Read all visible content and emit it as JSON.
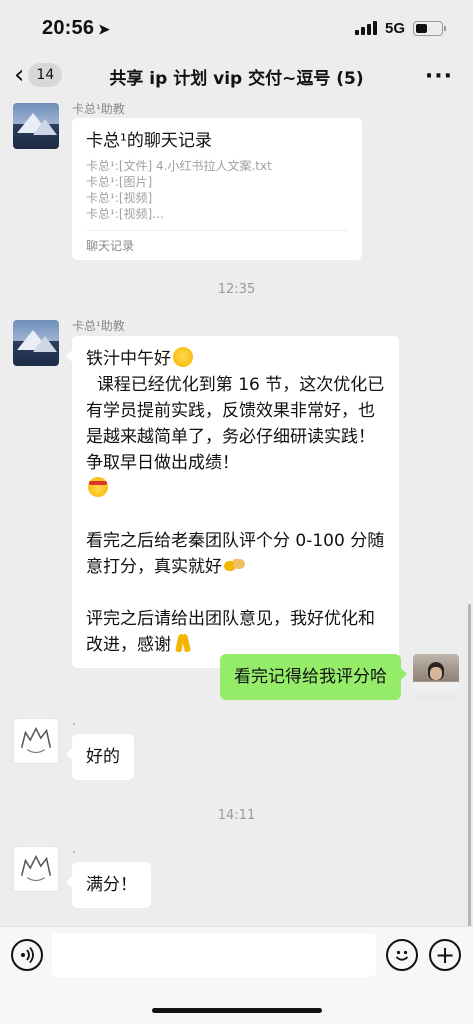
{
  "status_bar": {
    "time": "20:56",
    "location_glyph": "➤",
    "network": "5G",
    "battery_level": 0.45
  },
  "nav": {
    "back_glyph": "‹",
    "back_count": "14",
    "title": "共享 ip 计划 vip 交付~逗号 (5)",
    "more_glyph": "···"
  },
  "messages": {
    "record": {
      "sender": "卡总¹助教",
      "title": "卡总¹的聊天记录",
      "lines": [
        "卡总¹:[文件] 4.小红书拉人文案.txt",
        "卡总¹:[图片]",
        "卡总¹:[视频]",
        "卡总¹:[视频]..."
      ],
      "footer": "聊天记录"
    },
    "timestamp_1": "12:35",
    "long": {
      "sender": "卡总¹助教",
      "p1": "铁汁中午好",
      "p2": "  课程已经优化到第 16 节，这次优化已有学员提前实践，反馈效果非常好，也是越来越简单了，务必仔细研读实践！争取早日做出成绩！",
      "p3": "看完之后给老秦团队评个分 0-100 分随意打分，真实就好",
      "p4": "评完之后请给出团队意见，我好优化和改进，感谢"
    },
    "mine": {
      "text": "看完记得给我评分哈"
    },
    "reply_1": {
      "sender": ".",
      "text": "好的"
    },
    "timestamp_2": "14:11",
    "reply_2": {
      "sender": ".",
      "text": "满分！"
    }
  },
  "input_bar": {
    "placeholder": "",
    "voice_glyph": "◖))",
    "emoji_glyph": "☺",
    "plus_glyph": "+"
  }
}
